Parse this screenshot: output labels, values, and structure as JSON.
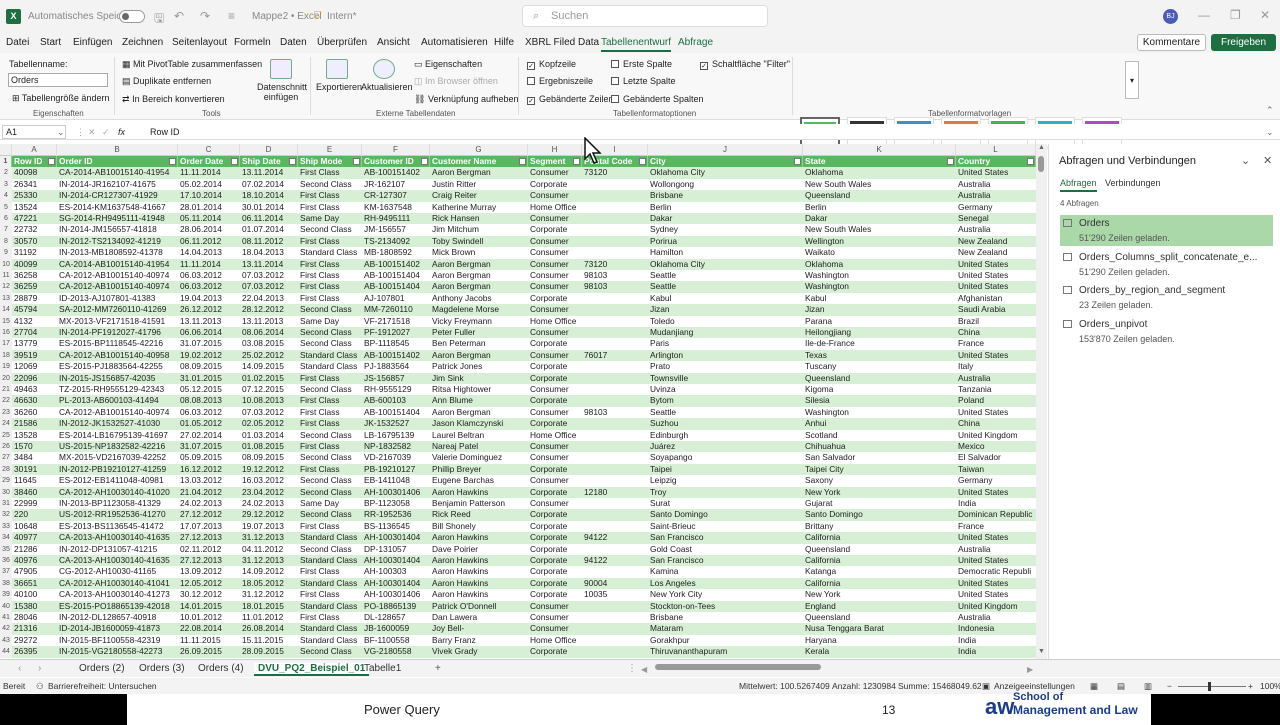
{
  "titlebar": {
    "autosave": "Automatisches Speichern",
    "doc": "Mappe2 • Excel",
    "label": "Intern*",
    "search": "Suchen",
    "avatar": "BJ"
  },
  "menu": [
    "Datei",
    "Start",
    "Einfügen",
    "Zeichnen",
    "Seitenlayout",
    "Formeln",
    "Daten",
    "Überprüfen",
    "Ansicht",
    "Automatisieren",
    "Hilfe",
    "XBRL Filed Data",
    "Tabellenentwurf",
    "Abfrage"
  ],
  "buttons": {
    "comments": "Kommentare",
    "share": "Freigeben"
  },
  "ribbon": {
    "tn_label": "Tabellenname:",
    "tn_value": "Orders",
    "resize": "Tabellengröße ändern",
    "grp1": "Eigenschaften",
    "pivot": "Mit PivotTable zusammenfassen",
    "dup": "Duplikate entfernen",
    "conv": "In Bereich konvertieren",
    "grp2": "Tools",
    "slicer": "Datenschnitt einfügen",
    "export": "Exportieren",
    "refresh": "Aktualisieren",
    "props": "Eigenschaften",
    "browser": "Im Browser öffnen",
    "unlink": "Verknüpfung aufheben",
    "grp3": "Externe Tabellendaten",
    "opt1": "Kopfzeile",
    "opt2": "Ergebniszeile",
    "opt3": "Gebänderte Zeilen",
    "opt4": "Erste Spalte",
    "opt5": "Letzte Spalte",
    "opt6": "Gebänderte Spalten",
    "opt7": "Schaltfläche \"Filter\"",
    "grp4": "Tabellenformatoptionen",
    "grp5": "Tabellenformatvorlagen"
  },
  "formula": {
    "cell": "A1",
    "fx": "fx",
    "value": "Row ID"
  },
  "columns": [
    "A",
    "B",
    "C",
    "D",
    "E",
    "F",
    "G",
    "H",
    "I",
    "J",
    "K",
    "L"
  ],
  "headers": [
    "Row ID",
    "Order ID",
    "Order Date",
    "Ship Date",
    "Ship Mode",
    "Customer ID",
    "Customer Name",
    "Segment",
    "Postal Code",
    "City",
    "State",
    "Country"
  ],
  "rows": [
    [
      "40098",
      "CA-2014-AB10015140-41954",
      "11.11.2014",
      "13.11.2014",
      "First Class",
      "AB-100151402",
      "Aaron Bergman",
      "Consumer",
      "73120",
      "Oklahoma City",
      "Oklahoma",
      "United States"
    ],
    [
      "26341",
      "IN-2014-JR162107-41675",
      "05.02.2014",
      "07.02.2014",
      "Second Class",
      "JR-162107",
      "Justin Ritter",
      "Corporate",
      "",
      "Wollongong",
      "New South Wales",
      "Australia"
    ],
    [
      "25330",
      "IN-2014-CR127307-41929",
      "17.10.2014",
      "18.10.2014",
      "First Class",
      "CR-127307",
      "Craig Reiter",
      "Consumer",
      "",
      "Brisbane",
      "Queensland",
      "Australia"
    ],
    [
      "13524",
      "ES-2014-KM1637548-41667",
      "28.01.2014",
      "30.01.2014",
      "First Class",
      "KM-1637548",
      "Katherine Murray",
      "Home Office",
      "",
      "Berlin",
      "Berlin",
      "Germany"
    ],
    [
      "47221",
      "SG-2014-RH9495111-41948",
      "05.11.2014",
      "06.11.2014",
      "Same Day",
      "RH-9495111",
      "Rick Hansen",
      "Consumer",
      "",
      "Dakar",
      "Dakar",
      "Senegal"
    ],
    [
      "22732",
      "IN-2014-JM156557-41818",
      "28.06.2014",
      "01.07.2014",
      "Second Class",
      "JM-156557",
      "Jim Mitchum",
      "Corporate",
      "",
      "Sydney",
      "New South Wales",
      "Australia"
    ],
    [
      "30570",
      "IN-2012-TS2134092-41219",
      "06.11.2012",
      "08.11.2012",
      "First Class",
      "TS-2134092",
      "Toby Swindell",
      "Consumer",
      "",
      "Porirua",
      "Wellington",
      "New Zealand"
    ],
    [
      "31192",
      "IN-2013-MB1808592-41378",
      "14.04.2013",
      "18.04.2013",
      "Standard Class",
      "MB-1808592",
      "Mick Brown",
      "Consumer",
      "",
      "Hamilton",
      "Waikato",
      "New Zealand"
    ],
    [
      "40099",
      "CA-2014-AB10015140-41954",
      "11.11.2014",
      "13.11.2014",
      "First Class",
      "AB-100151402",
      "Aaron Bergman",
      "Consumer",
      "73120",
      "Oklahoma City",
      "Oklahoma",
      "United States"
    ],
    [
      "36258",
      "CA-2012-AB10015140-40974",
      "06.03.2012",
      "07.03.2012",
      "First Class",
      "AB-100151404",
      "Aaron Bergman",
      "Consumer",
      "98103",
      "Seattle",
      "Washington",
      "United States"
    ],
    [
      "36259",
      "CA-2012-AB10015140-40974",
      "06.03.2012",
      "07.03.2012",
      "First Class",
      "AB-100151404",
      "Aaron Bergman",
      "Consumer",
      "98103",
      "Seattle",
      "Washington",
      "United States"
    ],
    [
      "28879",
      "ID-2013-AJ107801-41383",
      "19.04.2013",
      "22.04.2013",
      "First Class",
      "AJ-107801",
      "Anthony Jacobs",
      "Corporate",
      "",
      "Kabul",
      "Kabul",
      "Afghanistan"
    ],
    [
      "45794",
      "SA-2012-MM7260110-41269",
      "26.12.2012",
      "28.12.2012",
      "Second Class",
      "MM-7260110",
      "Magdelene Morse",
      "Consumer",
      "",
      "Jizan",
      "Jizan",
      "Saudi Arabia"
    ],
    [
      "4132",
      "MX-2013-VF2171518-41591",
      "13.11.2013",
      "13.11.2013",
      "Same Day",
      "VF-2171518",
      "Vicky Freymann",
      "Home Office",
      "",
      "Toledo",
      "Parana",
      "Brazil"
    ],
    [
      "27704",
      "IN-2014-PF1912027-41796",
      "06.06.2014",
      "08.06.2014",
      "Second Class",
      "PF-1912027",
      "Peter Fuller",
      "Consumer",
      "",
      "Mudanjiang",
      "Heilongjiang",
      "China"
    ],
    [
      "13779",
      "ES-2015-BP1118545-42216",
      "31.07.2015",
      "03.08.2015",
      "Second Class",
      "BP-1118545",
      "Ben Peterman",
      "Corporate",
      "",
      "Paris",
      "Ile-de-France",
      "France"
    ],
    [
      "39519",
      "CA-2012-AB10015140-40958",
      "19.02.2012",
      "25.02.2012",
      "Standard Class",
      "AB-100151402",
      "Aaron Bergman",
      "Consumer",
      "76017",
      "Arlington",
      "Texas",
      "United States"
    ],
    [
      "12069",
      "ES-2015-PJ1883564-42255",
      "08.09.2015",
      "14.09.2015",
      "Standard Class",
      "PJ-1883564",
      "Patrick Jones",
      "Corporate",
      "",
      "Prato",
      "Tuscany",
      "Italy"
    ],
    [
      "22096",
      "IN-2015-JS156857-42035",
      "31.01.2015",
      "01.02.2015",
      "First Class",
      "JS-156857",
      "Jim Sink",
      "Corporate",
      "",
      "Townsville",
      "Queensland",
      "Australia"
    ],
    [
      "49463",
      "TZ-2015-RH9555129-42343",
      "05.12.2015",
      "07.12.2015",
      "Second Class",
      "RH-9555129",
      "Ritsa Hightower",
      "Consumer",
      "",
      "Uvinza",
      "Kigoma",
      "Tanzania"
    ],
    [
      "46630",
      "PL-2013-AB600103-41494",
      "08.08.2013",
      "10.08.2013",
      "First Class",
      "AB-600103",
      "Ann Blume",
      "Corporate",
      "",
      "Bytom",
      "Silesia",
      "Poland"
    ],
    [
      "36260",
      "CA-2012-AB10015140-40974",
      "06.03.2012",
      "07.03.2012",
      "First Class",
      "AB-100151404",
      "Aaron Bergman",
      "Consumer",
      "98103",
      "Seattle",
      "Washington",
      "United States"
    ],
    [
      "21586",
      "IN-2012-JK1532527-41030",
      "01.05.2012",
      "02.05.2012",
      "First Class",
      "JK-1532527",
      "Jason Klamczynski",
      "Corporate",
      "",
      "Suzhou",
      "Anhui",
      "China"
    ],
    [
      "13528",
      "ES-2014-LB16795139-41697",
      "27.02.2014",
      "01.03.2014",
      "Second Class",
      "LB-16795139",
      "Laurel Beltran",
      "Home Office",
      "",
      "Edinburgh",
      "Scotland",
      "United Kingdom"
    ],
    [
      "1570",
      "US-2015-NP1832582-42216",
      "31.07.2015",
      "01.08.2015",
      "First Class",
      "NP-1832582",
      "Nareaj Patel",
      "Consumer",
      "",
      "Juárez",
      "Chihuahua",
      "Mexico"
    ],
    [
      "3484",
      "MX-2015-VD2167039-42252",
      "05.09.2015",
      "08.09.2015",
      "Second Class",
      "VD-2167039",
      "Valerie Dominguez",
      "Consumer",
      "",
      "Soyapango",
      "San Salvador",
      "El Salvador"
    ],
    [
      "30191",
      "IN-2012-PB19210127-41259",
      "16.12.2012",
      "19.12.2012",
      "First Class",
      "PB-19210127",
      "Phillip Breyer",
      "Corporate",
      "",
      "Taipei",
      "Taipei City",
      "Taiwan"
    ],
    [
      "11645",
      "ES-2012-EB1411048-40981",
      "13.03.2012",
      "16.03.2012",
      "Second Class",
      "EB-1411048",
      "Eugene Barchas",
      "Consumer",
      "",
      "Leipzig",
      "Saxony",
      "Germany"
    ],
    [
      "38460",
      "CA-2012-AH10030140-41020",
      "21.04.2012",
      "23.04.2012",
      "Second Class",
      "AH-100301406",
      "Aaron Hawkins",
      "Corporate",
      "12180",
      "Troy",
      "New York",
      "United States"
    ],
    [
      "22999",
      "IN-2013-BP1123058-41329",
      "24.02.2013",
      "24.02.2013",
      "Same Day",
      "BP-1123058",
      "Benjamin Patterson",
      "Consumer",
      "",
      "Surat",
      "Gujarat",
      "India"
    ],
    [
      "220",
      "US-2012-RR1952536-41270",
      "27.12.2012",
      "29.12.2012",
      "Second Class",
      "RR-1952536",
      "Rick Reed",
      "Corporate",
      "",
      "Santo Domingo",
      "Santo Domingo",
      "Dominican Republic"
    ],
    [
      "10648",
      "ES-2013-BS1136545-41472",
      "17.07.2013",
      "19.07.2013",
      "First Class",
      "BS-1136545",
      "Bill Shonely",
      "Corporate",
      "",
      "Saint-Brieuc",
      "Brittany",
      "France"
    ],
    [
      "40977",
      "CA-2013-AH10030140-41635",
      "27.12.2013",
      "31.12.2013",
      "Standard Class",
      "AH-100301404",
      "Aaron Hawkins",
      "Corporate",
      "94122",
      "San Francisco",
      "California",
      "United States"
    ],
    [
      "21286",
      "IN-2012-DP131057-41215",
      "02.11.2012",
      "04.11.2012",
      "Second Class",
      "DP-131057",
      "Dave Poirier",
      "Corporate",
      "",
      "Gold Coast",
      "Queensland",
      "Australia"
    ],
    [
      "40976",
      "CA-2013-AH10030140-41635",
      "27.12.2013",
      "31.12.2013",
      "Standard Class",
      "AH-100301404",
      "Aaron Hawkins",
      "Corporate",
      "94122",
      "San Francisco",
      "California",
      "United States"
    ],
    [
      "47905",
      "CG-2012-AH10030-41165",
      "13.09.2012",
      "14.09.2012",
      "First Class",
      "AH-100303",
      "Aaron Hawkins",
      "Corporate",
      "",
      "Kamina",
      "Katanga",
      "Democratic Republi"
    ],
    [
      "36651",
      "CA-2012-AH10030140-41041",
      "12.05.2012",
      "18.05.2012",
      "Standard Class",
      "AH-100301404",
      "Aaron Hawkins",
      "Corporate",
      "90004",
      "Los Angeles",
      "California",
      "United States"
    ],
    [
      "40100",
      "CA-2013-AH10030140-41273",
      "30.12.2012",
      "31.12.2012",
      "First Class",
      "AH-100301406",
      "Aaron Hawkins",
      "Corporate",
      "10035",
      "New York City",
      "New York",
      "United States"
    ],
    [
      "15380",
      "ES-2015-PO18865139-42018",
      "14.01.2015",
      "18.01.2015",
      "Standard Class",
      "PO-18865139",
      "Patrick O'Donnell",
      "Consumer",
      "",
      "Stockton-on-Tees",
      "England",
      "United Kingdom"
    ],
    [
      "28046",
      "IN-2012-DL128657-40918",
      "10.01.2012",
      "11.01.2012",
      "First Class",
      "DL-128657",
      "Dan Lawera",
      "Consumer",
      "",
      "Brisbane",
      "Queensland",
      "Australia"
    ],
    [
      "21316",
      "ID-2014-JB1600059-41873",
      "22.08.2014",
      "26.08.2014",
      "Standard Class",
      "JB-1600059",
      "Joy Bell-",
      "Consumer",
      "",
      "Mataram",
      "Nusa Tenggara Barat",
      "Indonesia"
    ],
    [
      "29272",
      "IN-2015-BF1100558-42319",
      "11.11.2015",
      "15.11.2015",
      "Standard Class",
      "BF-1100558",
      "Barry Franz",
      "Home Office",
      "",
      "Gorakhpur",
      "Haryana",
      "India"
    ],
    [
      "26395",
      "IN-2015-VG2180558-42273",
      "26.09.2015",
      "28.09.2015",
      "Second Class",
      "VG-2180558",
      "Vivek Grady",
      "Corporate",
      "",
      "Thiruvananthapuram",
      "Kerala",
      "India"
    ]
  ],
  "pane": {
    "title": "Abfragen und Verbindungen",
    "tab1": "Abfragen",
    "tab2": "Verbindungen",
    "count": "4 Abfragen",
    "queries": [
      {
        "name": "Orders",
        "status": "51'290 Zeilen geladen."
      },
      {
        "name": "Orders_Columns_split_concatenate_e...",
        "status": "51'290 Zeilen geladen."
      },
      {
        "name": "Orders_by_region_and_segment",
        "status": "23 Zeilen geladen."
      },
      {
        "name": "Orders_unpivot",
        "status": "153'870 Zeilen geladen."
      }
    ]
  },
  "sheets": [
    "Orders (2)",
    "Orders (3)",
    "Orders (4)",
    "DVU_PQ2_Beispiel_01",
    "Tabelle1"
  ],
  "status": {
    "ready": "Bereit",
    "access": "Barrierefreiheit: Untersuchen",
    "avg": "Mittelwert: 100.5267409",
    "count": "Anzahl: 1230984",
    "sum": "Summe: 15468049.62",
    "display": "Anzeigeeinstellungen",
    "zoom": "100%"
  },
  "footer": {
    "left": "Power Query",
    "page": "13",
    "school1": "School of",
    "school2": "Management and Law",
    "logo": "aw"
  }
}
